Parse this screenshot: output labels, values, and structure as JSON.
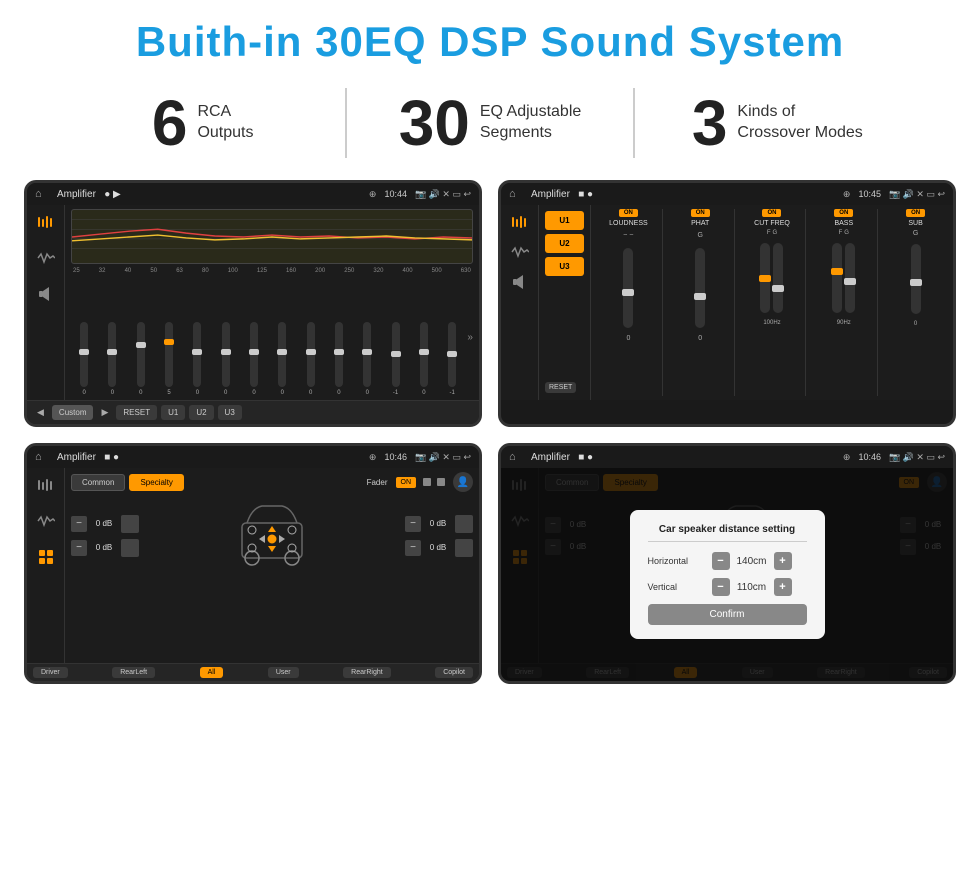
{
  "header": {
    "title": "Buith-in 30EQ DSP Sound System"
  },
  "stats": [
    {
      "number": "6",
      "text": "RCA\nOutputs"
    },
    {
      "number": "30",
      "text": "EQ Adjustable\nSegments"
    },
    {
      "number": "3",
      "text": "Kinds of\nCrossover Modes"
    }
  ],
  "screens": {
    "screen1": {
      "title": "Amplifier",
      "time": "10:44",
      "status": "● ▶",
      "freqs": [
        "25",
        "32",
        "40",
        "50",
        "63",
        "80",
        "100",
        "125",
        "160",
        "200",
        "250",
        "320",
        "400",
        "500",
        "630"
      ],
      "values": [
        "0",
        "0",
        "0",
        "5",
        "0",
        "0",
        "0",
        "0",
        "0",
        "0",
        "0",
        "-1",
        "0",
        "-1"
      ],
      "presets": [
        "Custom",
        "RESET",
        "U1",
        "U2",
        "U3"
      ]
    },
    "screen2": {
      "title": "Amplifier",
      "time": "10:45",
      "status": "■ ●",
      "uButtons": [
        "U1",
        "U2",
        "U3"
      ],
      "controls": [
        {
          "label": "LOUDNESS",
          "on": true
        },
        {
          "label": "PHAT",
          "on": true
        },
        {
          "label": "CUT FREQ",
          "on": true
        },
        {
          "label": "BASS",
          "on": true
        },
        {
          "label": "SUB",
          "on": true
        }
      ],
      "resetBtn": "RESET"
    },
    "screen3": {
      "title": "Amplifier",
      "time": "10:46",
      "status": "■ ●",
      "tabs": [
        "Common",
        "Specialty"
      ],
      "faderLabel": "Fader",
      "faderOn": "ON",
      "volRows": [
        {
          "val": "0 dB"
        },
        {
          "val": "0 dB"
        },
        {
          "val": "0 dB"
        },
        {
          "val": "0 dB"
        }
      ],
      "bottomBtns": [
        "Driver",
        "RearLeft",
        "All",
        "User",
        "RearRight",
        "Copilot"
      ]
    },
    "screen4": {
      "title": "Amplifier",
      "time": "10:46",
      "status": "■ ●",
      "tabs": [
        "Common",
        "Specialty"
      ],
      "dialog": {
        "title": "Car speaker distance setting",
        "rows": [
          {
            "label": "Horizontal",
            "value": "140cm"
          },
          {
            "label": "Vertical",
            "value": "110cm"
          }
        ],
        "confirmBtn": "Confirm"
      },
      "bottomBtns": [
        "Driver",
        "RearLeft",
        "All",
        "User",
        "RearRight",
        "Copilot"
      ]
    }
  },
  "colors": {
    "accent": "#1a9de0",
    "orange": "#f90",
    "dark_bg": "#1c1c1c",
    "title_blue": "#1a9de0"
  }
}
